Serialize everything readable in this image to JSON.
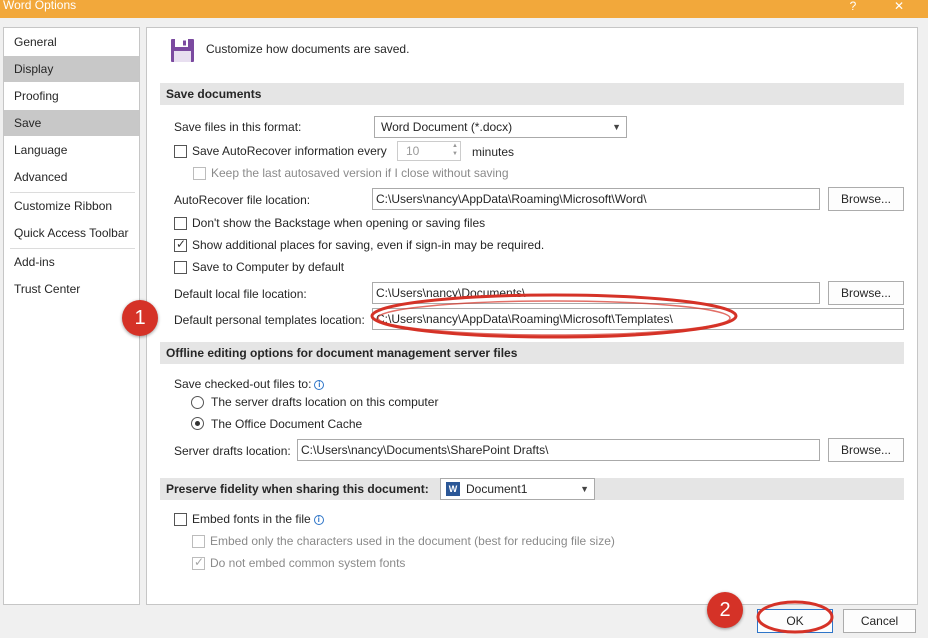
{
  "window": {
    "title": "Word Options",
    "help_glyph": "?",
    "close_glyph": "✕"
  },
  "sidebar": {
    "items": [
      {
        "label": "General",
        "selected": false
      },
      {
        "label": "Display",
        "selected": true
      },
      {
        "label": "Proofing",
        "selected": false
      },
      {
        "label": "Save",
        "selected": true
      },
      {
        "label": "Language",
        "selected": false
      },
      {
        "label": "Advanced",
        "selected": false
      },
      {
        "label": "Customize Ribbon",
        "selected": false
      },
      {
        "label": "Quick Access Toolbar",
        "selected": false
      },
      {
        "label": "Add-ins",
        "selected": false
      },
      {
        "label": "Trust Center",
        "selected": false
      }
    ]
  },
  "header": {
    "text": "Customize how documents are saved."
  },
  "save_documents": {
    "section_title": "Save documents",
    "format_label": "Save files in this format:",
    "format_value": "Word Document (*.docx)",
    "autorecover_label": "Save AutoRecover information every",
    "autorecover_checked": false,
    "autorecover_minutes": "10",
    "minutes_label": "minutes",
    "keep_last_label": "Keep the last autosaved version if I close without saving",
    "autorecover_location_label": "AutoRecover file location:",
    "autorecover_location_value": "C:\\Users\\nancy\\AppData\\Roaming\\Microsoft\\Word\\",
    "browse_label": "Browse...",
    "dont_show_backstage_label": "Don't show the Backstage when opening or saving files",
    "show_additional_label": "Show additional places for saving, even if sign-in may be required.",
    "save_to_computer_label": "Save to Computer by default",
    "default_local_label": "Default local file location:",
    "default_local_value": "C:\\Users\\nancy\\Documents\\",
    "default_templates_label": "Default personal templates location:",
    "default_templates_value": "C:\\Users\\nancy\\AppData\\Roaming\\Microsoft\\Templates\\"
  },
  "offline": {
    "section_title": "Offline editing options for document management server files",
    "save_checked_out_label": "Save checked-out files to:",
    "server_drafts_radio_label": "The server drafts location on this computer",
    "office_cache_radio_label": "The Office Document Cache",
    "server_drafts_location_label": "Server drafts location:",
    "server_drafts_location_value": "C:\\Users\\nancy\\Documents\\SharePoint Drafts\\"
  },
  "fidelity": {
    "section_title": "Preserve fidelity when sharing this document:",
    "document_value": "Document1",
    "embed_fonts_label": "Embed fonts in the file",
    "embed_only_label": "Embed only the characters used in the document (best for reducing file size)",
    "do_not_embed_label": "Do not embed common system fonts"
  },
  "buttons": {
    "ok_label": "OK",
    "cancel_label": "Cancel"
  },
  "annotations": {
    "badge_1": "1",
    "badge_2": "2"
  },
  "colors": {
    "title_bar": "#f2a83b",
    "annotation_red": "#d53227",
    "selected_nav": "#c8c8c8",
    "save_icon": "#7b4aa0"
  }
}
